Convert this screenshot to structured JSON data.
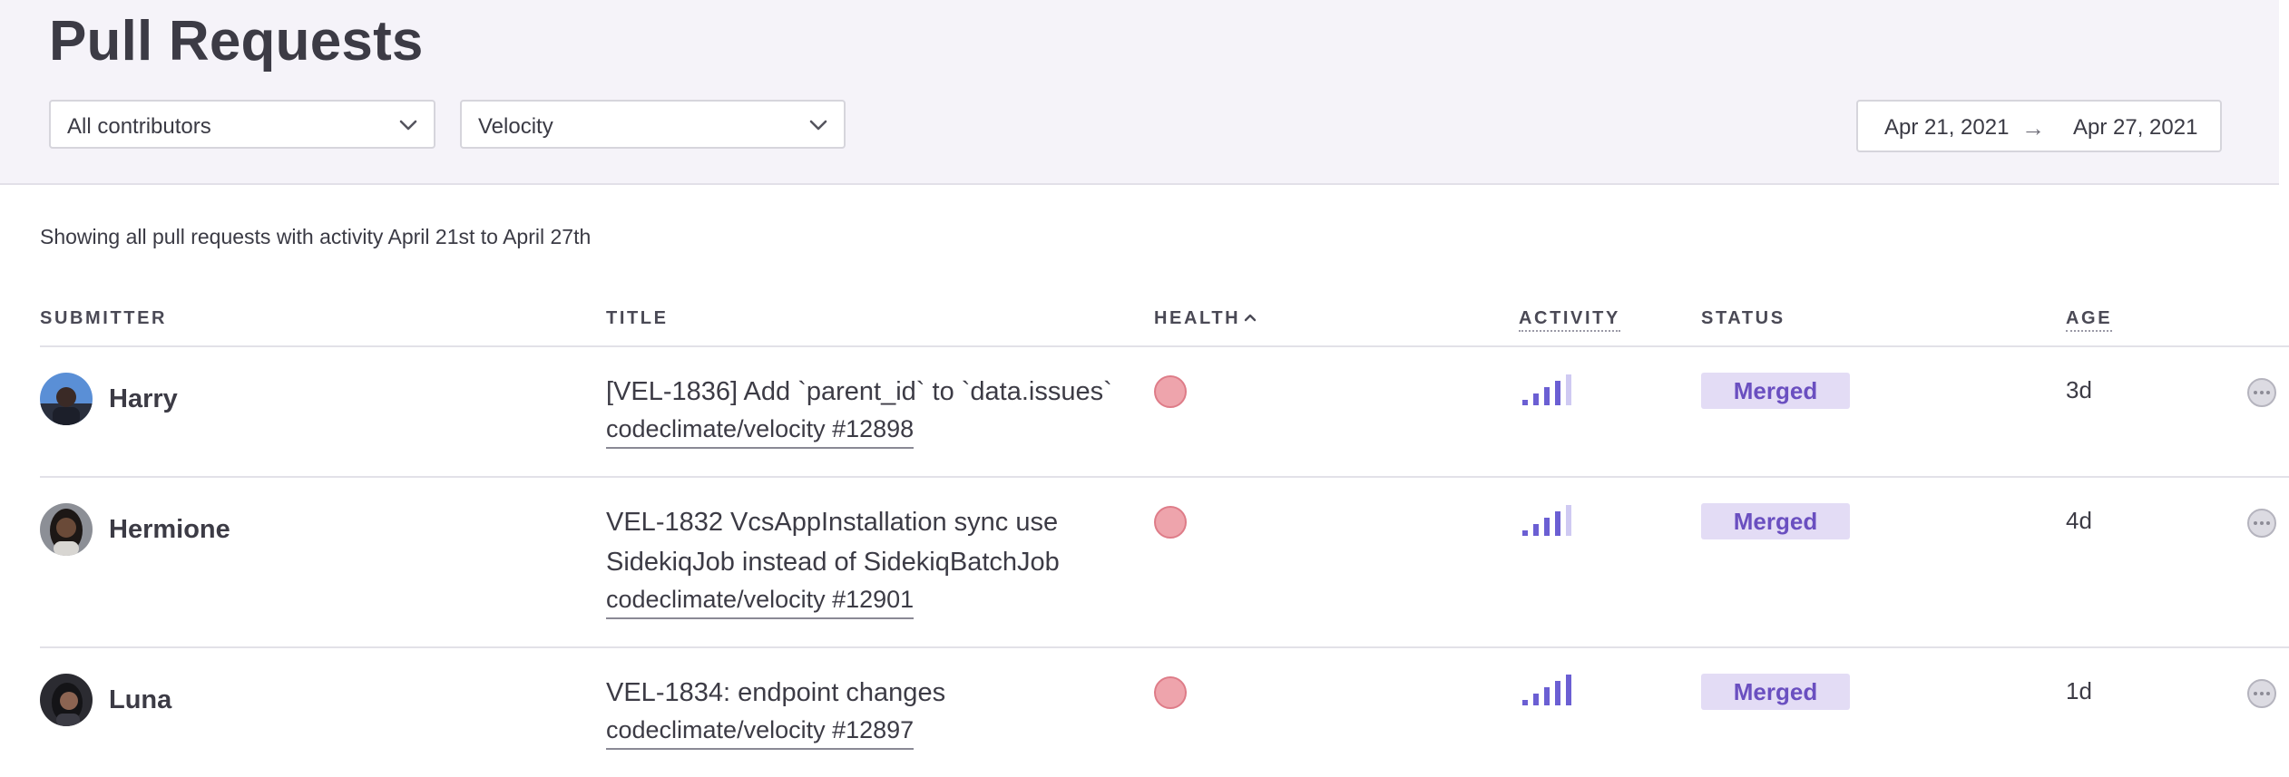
{
  "page": {
    "title": "Pull Requests"
  },
  "filters": {
    "contributors": {
      "value": "All contributors"
    },
    "metric": {
      "value": "Velocity"
    }
  },
  "date_range": {
    "start": "Apr 21, 2021",
    "arrow": "→",
    "end": "Apr 27, 2021"
  },
  "summary": "Showing all pull requests with activity April 21st to April 27th",
  "columns": {
    "submitter": "SUBMITTER",
    "title": "TITLE",
    "health": "HEALTH",
    "activity": "ACTIVITY",
    "status": "STATUS",
    "age": "AGE"
  },
  "colors": {
    "header_bg": "#f5f3f9",
    "health_poor": "#eea4ac",
    "activity_bar": "#6b5fd3",
    "activity_bar_dim": "#cfcaf2",
    "status_bg": "#e3dcf5",
    "status_text": "#6a4fc0"
  },
  "rows": [
    {
      "submitter": "Harry",
      "title_lines": [
        "[VEL-1836] Add `parent_id` to `data.issues`"
      ],
      "repo": "codeclimate/velocity #12898",
      "health": "poor",
      "activity_level": 4,
      "status": "Merged",
      "age": "3d"
    },
    {
      "submitter": "Hermione",
      "title_lines": [
        "VEL-1832 VcsAppInstallation sync use",
        "SidekiqJob instead of SidekiqBatchJob"
      ],
      "repo": "codeclimate/velocity #12901",
      "health": "poor",
      "activity_level": 4,
      "status": "Merged",
      "age": "4d"
    },
    {
      "submitter": "Luna",
      "title_lines": [
        "VEL-1834: endpoint changes"
      ],
      "repo": "codeclimate/velocity #12897",
      "health": "poor",
      "activity_level": 5,
      "status": "Merged",
      "age": "1d"
    }
  ]
}
